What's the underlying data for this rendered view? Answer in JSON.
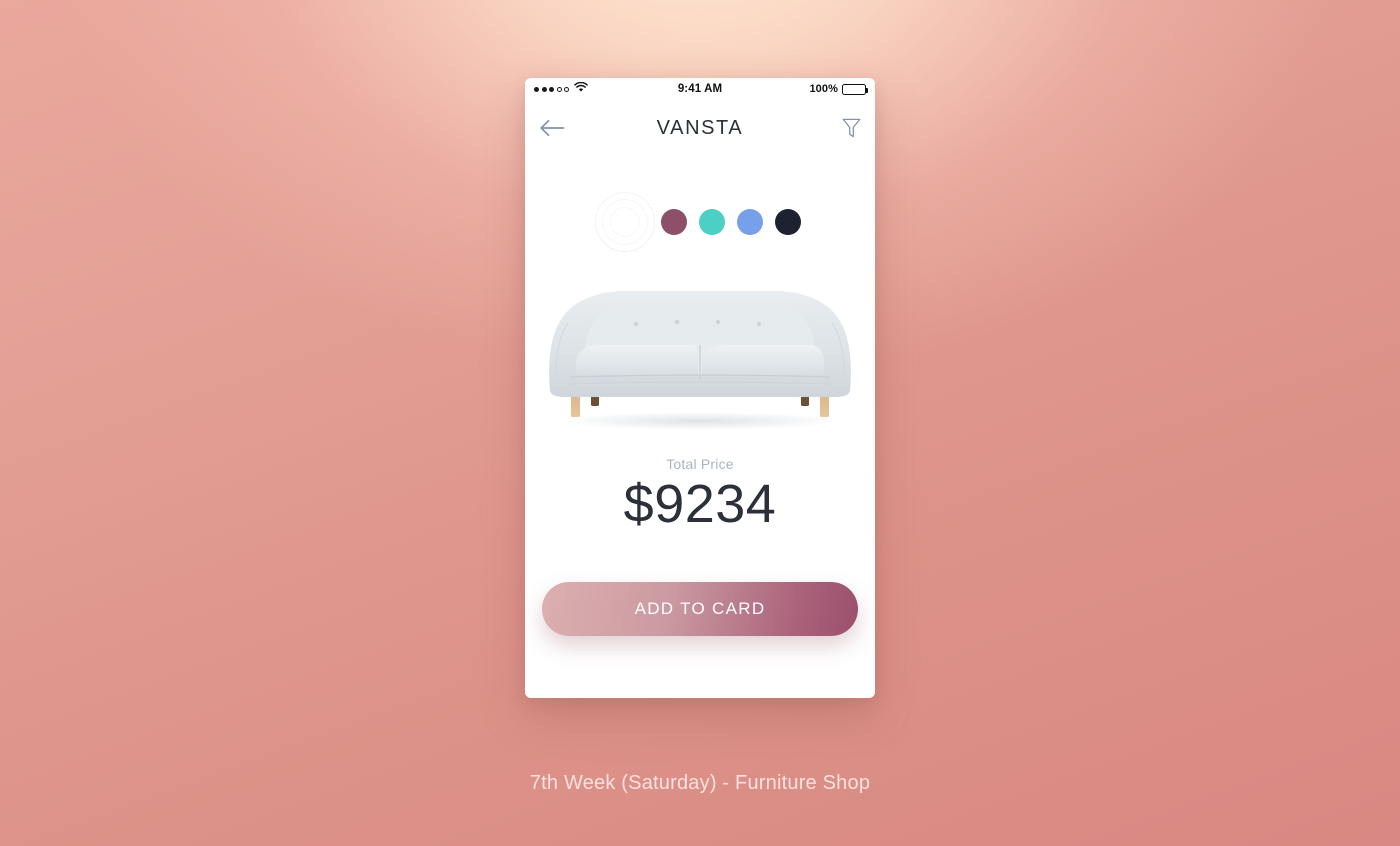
{
  "caption": "7th Week (Saturday) - Furniture Shop",
  "phone": {
    "status_bar": {
      "signal_dots_filled": 3,
      "signal_dots_total": 5,
      "wifi_icon": "wifi-icon",
      "time": "9:41 AM",
      "battery_percent": "100%",
      "battery_level": 100
    },
    "nav": {
      "back_icon": "arrow-left-icon",
      "title": "VANSTA",
      "filter_icon": "filter-funnel-icon"
    },
    "colors": {
      "selected_index": 0,
      "swatches": [
        {
          "name": "white",
          "hex": "#ffffff",
          "selected": true
        },
        {
          "name": "plum",
          "hex": "#8e4f68",
          "selected": false
        },
        {
          "name": "turquoise",
          "hex": "#4ccfc4",
          "selected": false
        },
        {
          "name": "cornflower-blue",
          "hex": "#77a0ea",
          "selected": false
        },
        {
          "name": "charcoal-navy",
          "hex": "#1d2230",
          "selected": false
        }
      ]
    },
    "product": {
      "image_name": "sofa-product-image",
      "alt": "Light grey three-seat sofa with wooden legs"
    },
    "price": {
      "label": "Total Price",
      "value": "$9234",
      "label_color": "#aab4c4",
      "value_color": "#2b303a"
    },
    "cta": {
      "label": "ADD TO CARD",
      "gradient_from": "#dcafb0",
      "gradient_to": "#9b4f6c"
    }
  }
}
